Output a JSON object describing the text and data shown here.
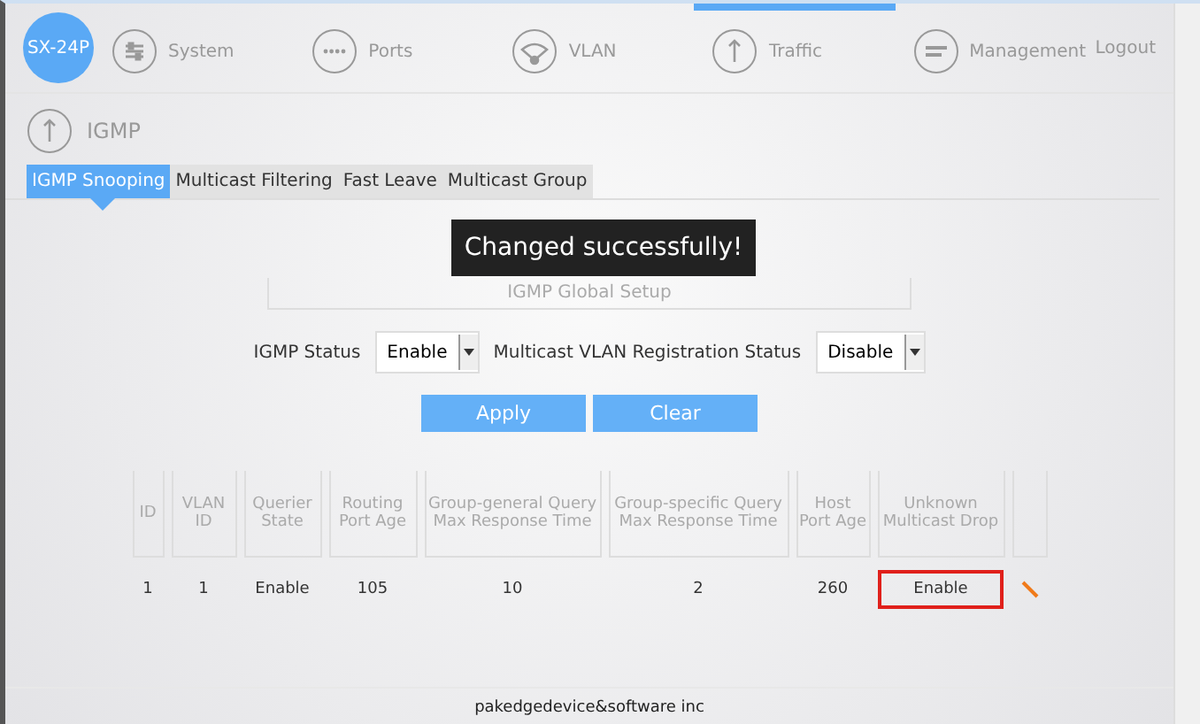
{
  "nav": {
    "logo": "SX-24P",
    "items": [
      {
        "label": "System",
        "selected": false
      },
      {
        "label": "Ports",
        "selected": false
      },
      {
        "label": "VLAN",
        "selected": false
      },
      {
        "label": "Traffic",
        "selected": true
      },
      {
        "label": "Management",
        "selected": false
      }
    ],
    "logout": "Logout"
  },
  "section": {
    "title": "IGMP"
  },
  "tabs": [
    {
      "label": "IGMP Snooping",
      "selected": true
    },
    {
      "label": "Multicast Filtering",
      "selected": false
    },
    {
      "label": "Fast Leave",
      "selected": false
    },
    {
      "label": "Multicast Group",
      "selected": false
    }
  ],
  "toast": "Changed successfully!",
  "setup": {
    "title": "IGMP Global Setup",
    "fields": [
      {
        "label": "IGMP Status",
        "value": "Enable"
      },
      {
        "label": "Multicast VLAN Registration Status",
        "value": "Disable"
      }
    ],
    "buttons": [
      "Apply",
      "Clear"
    ]
  },
  "table": {
    "columns": [
      "ID",
      "VLAN ID",
      "Querier State",
      "Routing Port Age",
      "Group-general Query Max Response Time",
      "Group-specific Query Max Response Time",
      "Host Port Age",
      "Unknown Multicast Drop"
    ],
    "rows": [
      {
        "cells": [
          {
            "text": "1",
            "highlighted": false
          },
          {
            "text": "1",
            "highlighted": false
          },
          {
            "text": "Enable",
            "highlighted": false
          },
          {
            "text": "105",
            "highlighted": false
          },
          {
            "text": "10",
            "highlighted": false
          },
          {
            "text": "2",
            "highlighted": false
          },
          {
            "text": "260",
            "highlighted": false
          },
          {
            "text": "Enable",
            "highlighted": true
          }
        ]
      }
    ]
  },
  "footer": "pakedgedevice&software inc"
}
